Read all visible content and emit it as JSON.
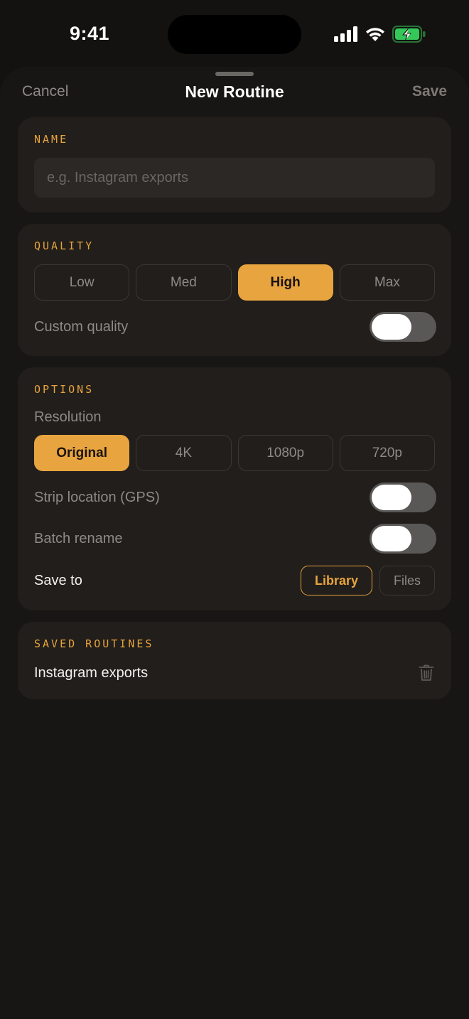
{
  "status_bar": {
    "time": "9:41",
    "icons": [
      "cellular-signal-icon",
      "wifi-icon",
      "battery-charging-icon"
    ],
    "battery_color": "#34c759"
  },
  "nav": {
    "cancel_label": "Cancel",
    "title": "New Routine",
    "save_label": "Save"
  },
  "name_section": {
    "label": "NAME",
    "input_value": "",
    "input_placeholder": "e.g. Instagram exports"
  },
  "quality_section": {
    "label": "QUALITY",
    "options": [
      "Low",
      "Med",
      "High",
      "Max"
    ],
    "selected": "High",
    "custom_quality_label": "Custom quality",
    "custom_quality_on": false
  },
  "options_section": {
    "label": "OPTIONS",
    "resolution_label": "Resolution",
    "resolution_options": [
      "Original",
      "4K",
      "1080p",
      "720p"
    ],
    "resolution_selected": "Original",
    "strip_location_label": "Strip location (GPS)",
    "strip_location_on": false,
    "batch_rename_label": "Batch rename",
    "batch_rename_on": false,
    "save_to_label": "Save to",
    "save_to_options": [
      "Library",
      "Files"
    ],
    "save_to_selected": "Library"
  },
  "saved_section": {
    "label": "SAVED ROUTINES",
    "items": [
      {
        "name": "Instagram exports",
        "action_icon": "trash-icon"
      }
    ]
  },
  "colors": {
    "accent": "#e8a43f",
    "background": "#141210",
    "card": "#211e1b"
  }
}
